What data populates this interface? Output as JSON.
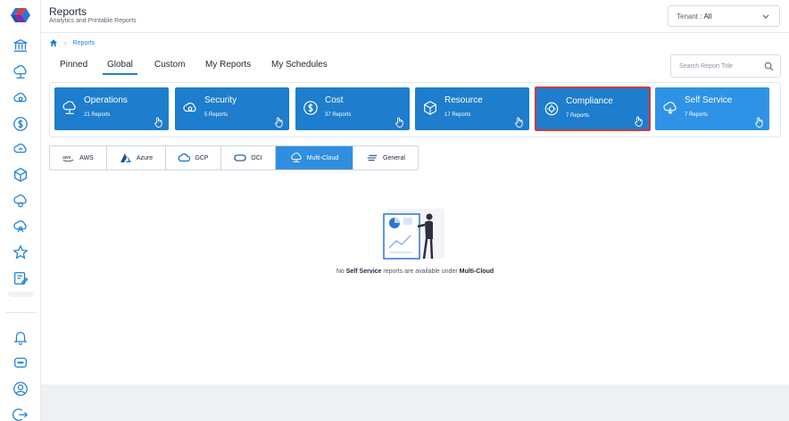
{
  "app": {
    "title": "Reports",
    "subtitle": "Analytics and Printable Reports"
  },
  "tenant": {
    "label": "Tenant :",
    "value": "All"
  },
  "breadcrumb": {
    "items": [
      "Reports"
    ]
  },
  "tabs": [
    {
      "label": "Pinned",
      "active": false
    },
    {
      "label": "Global",
      "active": true
    },
    {
      "label": "Custom",
      "active": false
    },
    {
      "label": "My Reports",
      "active": false
    },
    {
      "label": "My Schedules",
      "active": false
    }
  ],
  "search": {
    "placeholder": "Search Report Title"
  },
  "categories": [
    {
      "name": "Operations",
      "count": "21 Reports",
      "icon": "cloud-gear-icon"
    },
    {
      "name": "Security",
      "count": "5 Reports",
      "icon": "cloud-shield-icon"
    },
    {
      "name": "Cost",
      "count": "37 Reports",
      "icon": "dollar-circle-icon"
    },
    {
      "name": "Resource",
      "count": "17 Reports",
      "icon": "cube-icon"
    },
    {
      "name": "Compliance",
      "count": "7 Reports",
      "icon": "compliance-gear-icon",
      "selected": true
    },
    {
      "name": "Self Service",
      "count": "7 Reports",
      "icon": "cloud-service-icon"
    }
  ],
  "cloud_tabs": [
    {
      "label": "AWS",
      "icon": "aws-icon"
    },
    {
      "label": "Azure",
      "icon": "azure-icon"
    },
    {
      "label": "GCP",
      "icon": "gcp-icon"
    },
    {
      "label": "OCI",
      "icon": "oci-icon"
    },
    {
      "label": "Multi-Cloud",
      "icon": "multi-cloud-icon",
      "active": true
    },
    {
      "label": "General",
      "icon": "general-icon"
    }
  ],
  "empty_state": {
    "prefix": "No",
    "category": "Self Service",
    "middle": "reports are available under",
    "cloud": "Multi-Cloud"
  },
  "colors": {
    "accent": "#1f7fd8",
    "card": "#1e7dcc",
    "card_light": "#2e93e6",
    "selected_border": "#d33a3a"
  }
}
